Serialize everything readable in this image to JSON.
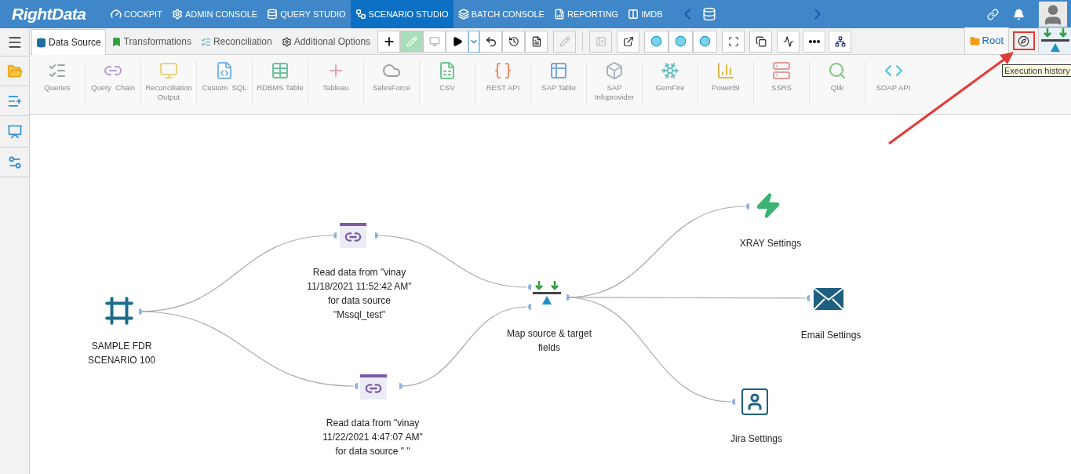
{
  "logo": "RightData",
  "nav": [
    {
      "label": "COCKPIT",
      "selected": false
    },
    {
      "label": "ADMIN CONSOLE",
      "selected": false
    },
    {
      "label": "QUERY STUDIO",
      "selected": false
    },
    {
      "label": "SCENARIO STUDIO",
      "selected": true
    },
    {
      "label": "BATCH CONSOLE",
      "selected": false
    },
    {
      "label": "REPORTING",
      "selected": false
    },
    {
      "label": "IMDB",
      "selected": false
    }
  ],
  "tabs": [
    {
      "label": "Data Source",
      "selected": true
    },
    {
      "label": "Transformations",
      "selected": false
    },
    {
      "label": "Reconciliation",
      "selected": false
    },
    {
      "label": "Additional Options",
      "selected": false
    }
  ],
  "root_label": "Root",
  "tooltip": "Execution history",
  "sources": [
    {
      "label": "Queries"
    },
    {
      "label": "Query  Chain"
    },
    {
      "label": "Reconciliation Output"
    },
    {
      "label": "Custom  SQL"
    },
    {
      "label": "RDBMS Table"
    },
    {
      "label": "Tableau"
    },
    {
      "label": "SalesForce"
    },
    {
      "label": "CSV"
    },
    {
      "label": "REST API"
    },
    {
      "label": "SAP Table"
    },
    {
      "label": "SAP Infoprovider"
    },
    {
      "label": "GemFire"
    },
    {
      "label": "PowerBI"
    },
    {
      "label": "SSRS"
    },
    {
      "label": "Qlik"
    },
    {
      "label": "SOAP API"
    }
  ],
  "nodes": [
    {
      "kind": "scenario",
      "lines": [
        "SAMPLE FDR",
        "SCENARIO 100"
      ]
    },
    {
      "kind": "query_chain",
      "lines": [
        "Read data from \"vinay",
        "11/18/2021 11:52:42 AM\"",
        "for data source",
        "\"Mssql_test\""
      ]
    },
    {
      "kind": "query_chain",
      "lines": [
        "Read data from \"vinay",
        "11/22/2021 4:47:07 AM\"",
        "for data source \" \""
      ]
    },
    {
      "kind": "map",
      "lines": [
        "Map source & target",
        "fields"
      ]
    },
    {
      "kind": "xray",
      "lines": [
        "XRAY Settings"
      ]
    },
    {
      "kind": "email",
      "lines": [
        "Email Settings"
      ]
    },
    {
      "kind": "jira",
      "lines": [
        "Jira Settings"
      ]
    }
  ]
}
